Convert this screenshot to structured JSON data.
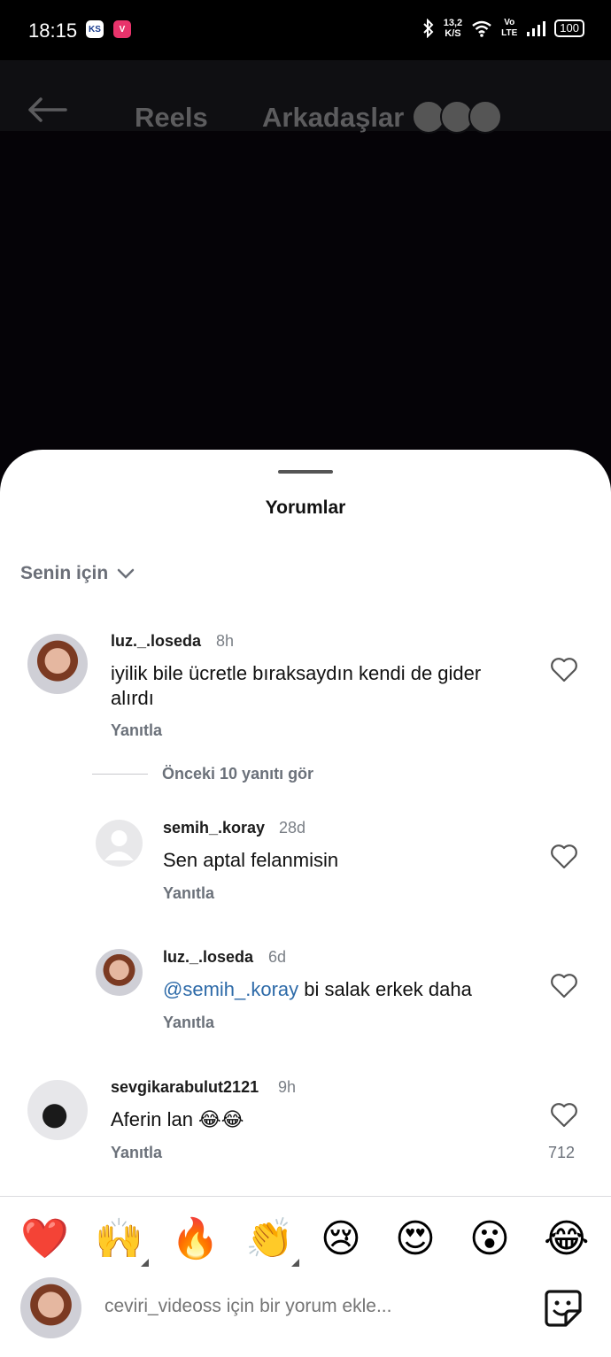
{
  "status_bar": {
    "time": "18:15",
    "app_badge_1": "KS",
    "app_badge_2": "V",
    "net_speed_value": "13,2",
    "net_speed_unit": "K/S",
    "volte_top": "Vo",
    "volte_bottom": "LTE",
    "battery": "100"
  },
  "header": {
    "tab_reels": "Reels",
    "tab_friends": "Arkadaşlar"
  },
  "sheet": {
    "title": "Yorumlar",
    "sort_label": "Senin için"
  },
  "comments": [
    {
      "username": "luz._.loseda",
      "time": "8h",
      "text": "iyilik bile ücretle bıraksaydın kendi de gider alırdı",
      "reply": "Yanıtla"
    },
    {
      "username": "sevgikarabulut2121",
      "time": "9h",
      "text": "Aferin lan 😂😂",
      "reply": "Yanıtla",
      "likes": "712"
    }
  ],
  "view_previous": "Önceki 10 yanıtı gör",
  "replies": [
    {
      "username": "semih_.koray",
      "time": "28d",
      "text": "Sen aptal felanmisin",
      "reply": "Yanıtla"
    },
    {
      "username": "luz._.loseda",
      "time": "6d",
      "mention": "@semih_.koray",
      "text": " bi salak erkek daha",
      "reply": "Yanıtla"
    }
  ],
  "emoji_bar": [
    "❤️",
    "🙌",
    "🔥",
    "👏",
    "😢",
    "😍",
    "😮",
    "😂"
  ],
  "compose": {
    "placeholder": "ceviri_videoss için bir yorum ekle..."
  },
  "colors": {
    "mention": "#2d6aa8",
    "sheet_bg": "#ffffff",
    "backdrop": "#050307"
  }
}
